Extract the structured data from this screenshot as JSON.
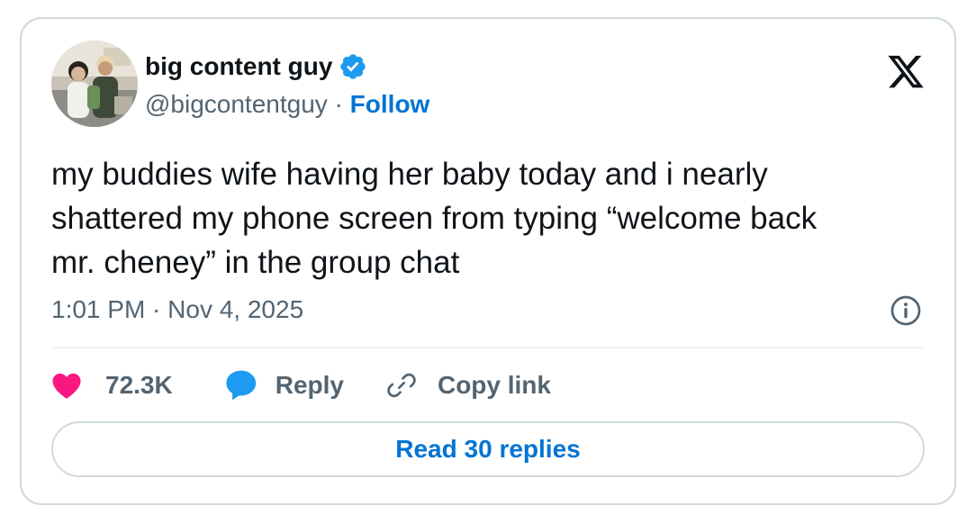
{
  "author": {
    "display_name": "big content guy",
    "handle": "@bigcontentguy",
    "separator": " · ",
    "follow_label": "Follow",
    "verified": true,
    "avatar_icon": "profile-photo"
  },
  "brand_icon": "x-logo-icon",
  "tweet": {
    "text_lines": [
      "my buddies wife having her baby today and i nearly",
      "shattered my phone screen from typing “welcome back",
      "mr. cheney” in the group chat"
    ],
    "timestamp": "1:01 PM · Nov 4, 2025"
  },
  "actions": {
    "like_count": "72.3K",
    "reply_label": "Reply",
    "copy_label": "Copy link"
  },
  "footer": {
    "read_replies_label": "Read 30 replies"
  },
  "colors": {
    "link": "#0074d4",
    "verified": "#1d9bf0",
    "like": "#f91880",
    "reply": "#1d9bf0",
    "secondary_text": "#536471",
    "border": "#cfd9de"
  }
}
